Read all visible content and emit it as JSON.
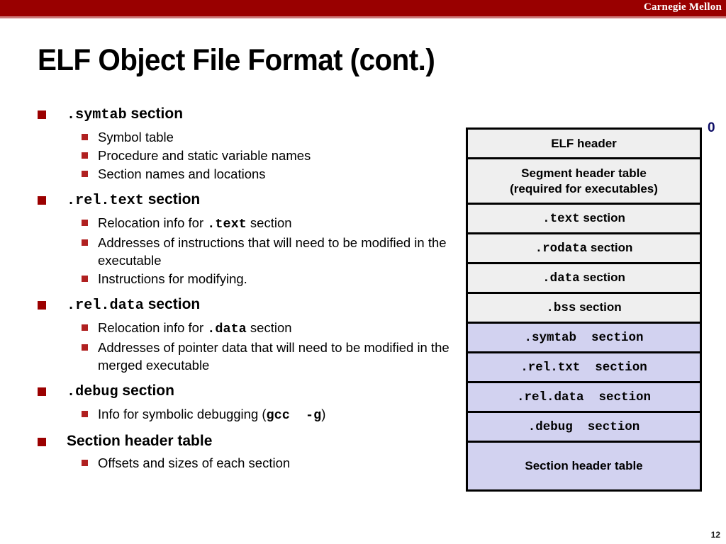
{
  "banner": {
    "brand": "Carnegie Mellon",
    "bar_color": "#990000",
    "stripe_color": "#cc7a7a"
  },
  "slide": {
    "title": "ELF Object File Format (cont.)",
    "page_number": "12",
    "bullet_color": "#9b0000",
    "subbullet_color": "#b02020"
  },
  "bullets": [
    {
      "label_mono": ".symtab",
      "label_text": " section",
      "children": [
        {
          "pre": "Symbol table",
          "mono": "",
          "post": ""
        },
        {
          "pre": "Procedure and static variable names",
          "mono": "",
          "post": ""
        },
        {
          "pre": "Section names and locations",
          "mono": "",
          "post": ""
        }
      ]
    },
    {
      "label_mono": ".rel.text",
      "label_text": " section",
      "children": [
        {
          "pre": "Relocation info for ",
          "mono": ".text",
          "post": " section"
        },
        {
          "pre": "Addresses of instructions that will need to be modified in the executable",
          "mono": "",
          "post": ""
        },
        {
          "pre": "Instructions for modifying.",
          "mono": "",
          "post": ""
        }
      ]
    },
    {
      "label_mono": ".rel.data",
      "label_text": " section",
      "children": [
        {
          "pre": "Relocation info for ",
          "mono": ".data",
          "post": " section"
        },
        {
          "pre": "Addresses of pointer data that will need to be modified in the merged executable",
          "mono": "",
          "post": ""
        }
      ]
    },
    {
      "label_mono": ".debug",
      "label_text": " section",
      "children": [
        {
          "pre": "Info for symbolic debugging (",
          "mono": "gcc  -g",
          "post": ")"
        }
      ]
    },
    {
      "label_mono": "",
      "label_text": "Section header table",
      "children": [
        {
          "pre": "Offsets and sizes of each section",
          "mono": "",
          "post": ""
        }
      ]
    }
  ],
  "diagram": {
    "offset_label": "0",
    "offset_label_color": "#0d0d66",
    "gray_fill": "#efefef",
    "lavender_fill": "#d2d2f0",
    "rows": [
      {
        "mono": "",
        "text": "ELF header",
        "fill": "gray",
        "lines": 1
      },
      {
        "mono": "",
        "text": "Segment header table\n(required for executables)",
        "fill": "gray",
        "lines": 2
      },
      {
        "mono": ".text",
        "text": " section",
        "fill": "gray",
        "lines": 1
      },
      {
        "mono": ".rodata",
        "text": " section",
        "fill": "gray",
        "lines": 1
      },
      {
        "mono": ".data",
        "text": " section",
        "fill": "gray",
        "lines": 1
      },
      {
        "mono": ".bss",
        "text": " section",
        "fill": "gray",
        "lines": 1
      },
      {
        "mono": ".symtab  section",
        "text": "",
        "fill": "lav",
        "lines": 1
      },
      {
        "mono": ".rel.txt  section",
        "text": "",
        "fill": "lav",
        "lines": 1
      },
      {
        "mono": ".rel.data  section",
        "text": "",
        "fill": "lav",
        "lines": 1
      },
      {
        "mono": ".debug  section",
        "text": "",
        "fill": "lav",
        "lines": 1
      },
      {
        "mono": "",
        "text": "Section header table",
        "fill": "lav",
        "lines": 1,
        "big": true
      }
    ]
  }
}
